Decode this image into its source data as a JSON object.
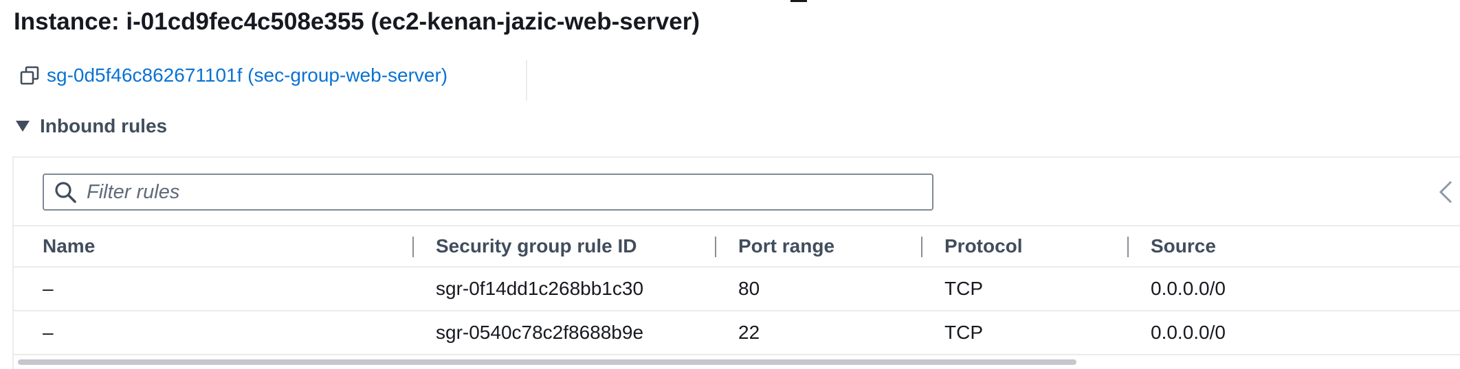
{
  "header": {
    "title": "Instance: i-01cd9fec4c508e355 (ec2-kenan-jazic-web-server)"
  },
  "security_group": {
    "link": "sg-0d5f46c862671101f (sec-group-web-server)",
    "icon": "copy-icon"
  },
  "inbound": {
    "section_label": "Inbound rules",
    "filter": {
      "placeholder": "Filter rules",
      "value": ""
    },
    "columns": [
      "Name",
      "Security group rule ID",
      "Port range",
      "Protocol",
      "Source"
    ],
    "rows": [
      [
        "–",
        "sgr-0f14dd1c268bb1c30",
        "80",
        "TCP",
        "0.0.0.0/0"
      ],
      [
        "–",
        "sgr-0540c78c2f8688b9e",
        "22",
        "TCP",
        "0.0.0.0/0"
      ]
    ]
  },
  "colors": {
    "link": "#0972d3",
    "text": "#16191f",
    "muted_header": "#414d5c",
    "border": "#e9ebed"
  }
}
